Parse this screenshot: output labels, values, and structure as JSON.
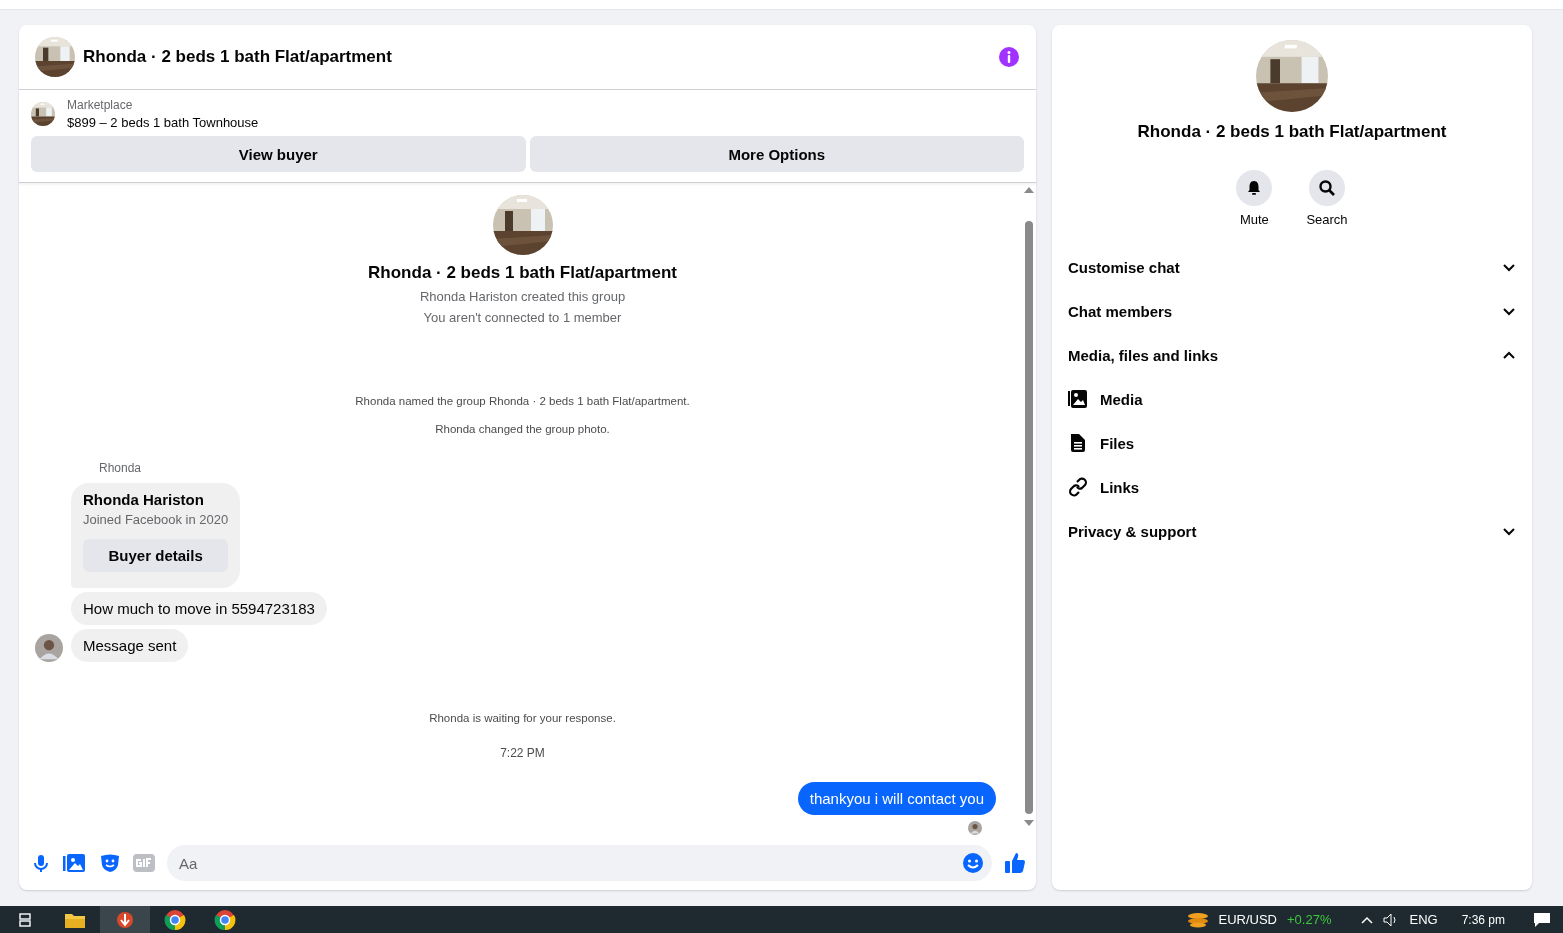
{
  "chat": {
    "title": "Rhonda · 2 beds 1 bath Flat/apartment",
    "listing": {
      "source": "Marketplace",
      "item": "$899 – 2 beds 1 bath Townhouse"
    },
    "actions": [
      "View buyer",
      "More Options"
    ],
    "intro": {
      "title": "Rhonda · 2 beds 1 bath Flat/apartment",
      "lines": [
        "Rhonda Hariston created this group",
        "You aren't connected to 1 member"
      ]
    },
    "events": [
      "Rhonda named the group Rhonda · 2 beds 1 bath Flat/apartment.",
      "Rhonda changed the group photo."
    ],
    "sender": "Rhonda",
    "card": {
      "name": "Rhonda Hariston",
      "subtitle": "Joined Facebook in 2020",
      "button": "Buyer details"
    },
    "incoming": [
      "How much to move in 5594723183",
      "Message sent"
    ],
    "status": "Rhonda is waiting for your response.",
    "time": "7:22 PM",
    "outgoing": [
      "thankyou i will contact you"
    ],
    "composer": {
      "placeholder": "Aa"
    }
  },
  "details": {
    "title": "Rhonda · 2 beds 1 bath Flat/apartment",
    "actions": [
      {
        "label": "Mute"
      },
      {
        "label": "Search"
      }
    ],
    "items": [
      {
        "kind": "section",
        "label": "Customise chat",
        "expanded": false
      },
      {
        "kind": "section",
        "label": "Chat members",
        "expanded": false
      },
      {
        "kind": "section",
        "label": "Media, files and links",
        "expanded": true
      },
      {
        "kind": "link",
        "label": "Media"
      },
      {
        "kind": "link",
        "label": "Files"
      },
      {
        "kind": "link",
        "label": "Links"
      },
      {
        "kind": "section",
        "label": "Privacy & support",
        "expanded": false
      }
    ]
  },
  "taskbar": {
    "ticker": "EUR/USD",
    "change": "+0.27%",
    "language": "ENG",
    "clock": "7:36 pm"
  }
}
